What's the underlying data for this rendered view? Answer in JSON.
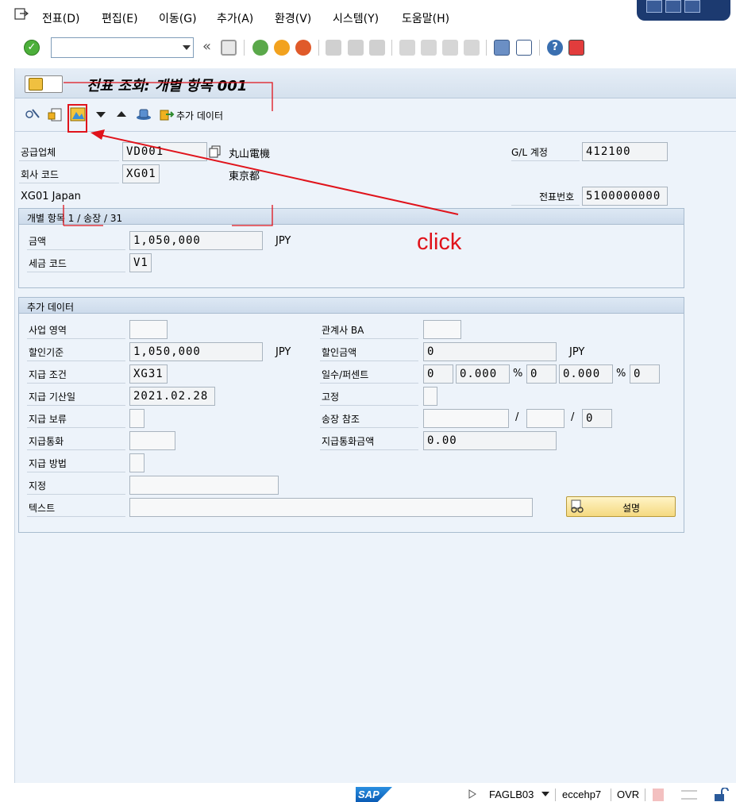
{
  "menu": {
    "items": [
      {
        "label": "전표(D)"
      },
      {
        "label": "편집(E)"
      },
      {
        "label": "이동(G)"
      },
      {
        "label": "추가(A)"
      },
      {
        "label": "환경(V)"
      },
      {
        "label": "시스템(Y)"
      },
      {
        "label": "도움말(H)"
      }
    ]
  },
  "toolbar": {
    "command_field_value": "",
    "back_symbol": "«"
  },
  "title": "전표 조회: 개별 항목 001",
  "app_toolbar": {
    "extra_data_label": "추가 데이터"
  },
  "header": {
    "vendor_label": "공급업체",
    "vendor_value": "VD001",
    "vendor_name": "丸山電機",
    "vendor_city": "東京都",
    "company_label": "회사 코드",
    "company_value": "XG01",
    "company_name": "XG01 Japan",
    "gl_label": "G/L 계정",
    "gl_value": "412100",
    "doc_label": "전표번호",
    "doc_value": "5100000000"
  },
  "item_group": {
    "title": "개별 항목 1 / 송장 / 31",
    "amount_label": "금액",
    "amount_value": "1,050,000",
    "amount_currency": "JPY",
    "tax_label": "세금 코드",
    "tax_value": "V1"
  },
  "extra_group": {
    "title": "추가 데이터",
    "business_area_label": "사업 영역",
    "business_area_value": "",
    "disc_base_label": "할인기준",
    "disc_base_value": "1,050,000",
    "disc_base_currency": "JPY",
    "pay_terms_label": "지급 조건",
    "pay_terms_value": "XG31",
    "baseline_label": "지급 기산일",
    "baseline_value": "2021.02.28",
    "pay_block_label": "지급 보류",
    "pay_block_value": "",
    "pay_currency_label": "지급통화",
    "pay_currency_value": "",
    "pay_method_label": "지급 방법",
    "pay_method_value": "",
    "assignment_label": "지정",
    "assignment_value": "",
    "text_label": "텍스트",
    "text_value": "",
    "trading_ba_label": "관계사 BA",
    "trading_ba_value": "",
    "disc_amount_label": "할인금액",
    "disc_amount_value": "0",
    "disc_amount_currency": "JPY",
    "days_pct_label": "일수/퍼센트",
    "days1": "0",
    "pct1": "0.000",
    "pct_sign": "%",
    "days2": "0",
    "pct2": "0.000",
    "days3": "0",
    "fixed_label": "고정",
    "fixed_value": "",
    "invoice_ref_label": "송장 참조",
    "invoice_ref_1": "",
    "invoice_ref_2": "",
    "invoice_ref_3": "0",
    "slash": "/",
    "pay_curr_amt_label": "지급통화금액",
    "pay_curr_amt_value": "0.00",
    "explain_button": "설명"
  },
  "status": {
    "sap_logo": "SAP",
    "transaction": "FAGLB03",
    "system": "eccehp7",
    "mode": "OVR"
  },
  "annotation": {
    "text": "click",
    "color": "#e0131b"
  }
}
